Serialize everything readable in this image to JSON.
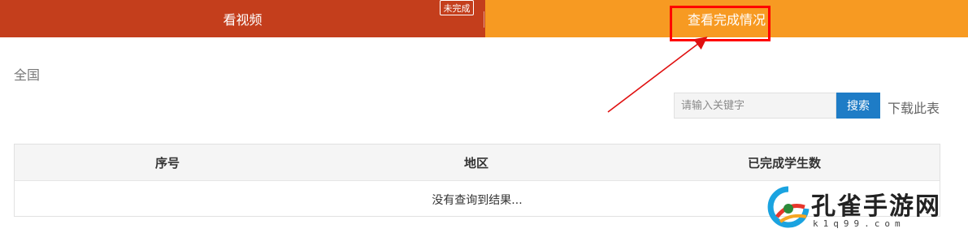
{
  "tabs": {
    "video_label": "看视频",
    "video_badge": "未完成",
    "status_label": "查看完成情况"
  },
  "filter": {
    "region": "全国"
  },
  "search": {
    "placeholder": "请输入关键字",
    "button_label": "搜索",
    "download_label": "下载此表"
  },
  "table": {
    "columns": [
      "序号",
      "地区",
      "已完成学生数"
    ],
    "empty_text": "没有查询到结果..."
  },
  "watermark": {
    "brand": "孔雀手游网",
    "domain": "k1q99.com"
  },
  "colors": {
    "tab_active": "#c43e1c",
    "tab_secondary": "#f79a22",
    "search_button": "#1e7cc6",
    "highlight": "#ff0000"
  }
}
